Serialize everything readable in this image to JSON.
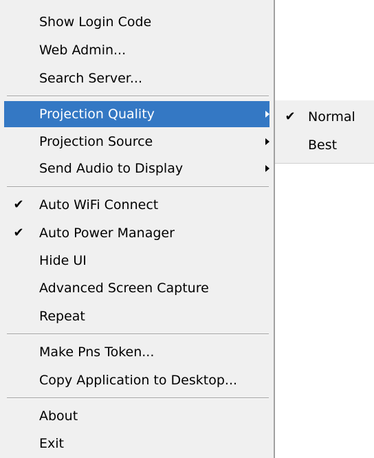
{
  "menu": {
    "items": [
      {
        "label": "Show Login Code"
      },
      {
        "label": "Web Admin..."
      },
      {
        "label": "Search Server..."
      },
      {
        "label": "Projection Quality",
        "has_submenu": true,
        "highlighted": true
      },
      {
        "label": "Projection Source",
        "has_submenu": true
      },
      {
        "label": "Send Audio to Display",
        "has_submenu": true
      },
      {
        "label": "Auto WiFi Connect",
        "checked": true
      },
      {
        "label": "Auto Power Manager",
        "checked": true
      },
      {
        "label": "Hide UI"
      },
      {
        "label": "Advanced Screen Capture"
      },
      {
        "label": "Repeat"
      },
      {
        "label": "Make Pns Token..."
      },
      {
        "label": "Copy Application to Desktop..."
      },
      {
        "label": "About"
      },
      {
        "label": "Exit"
      }
    ]
  },
  "submenu": {
    "items": [
      {
        "label": "Normal",
        "checked": true
      },
      {
        "label": "Best"
      }
    ]
  },
  "glyphs": {
    "check": "✔"
  },
  "colors": {
    "highlight": "#3478c4",
    "menu_bg": "#f0f0f0"
  }
}
